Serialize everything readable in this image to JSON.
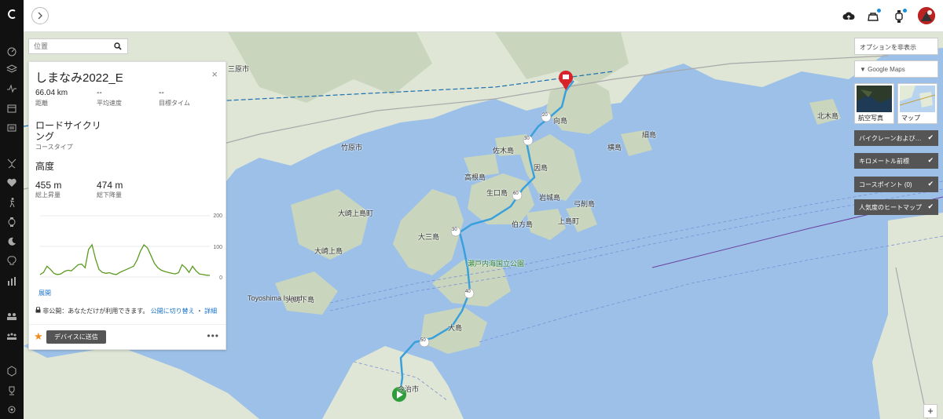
{
  "nav": {
    "icons": [
      "logo-icon",
      "dashboard-icon",
      "layers-icon",
      "activity-icon",
      "calendar-icon",
      "news-icon",
      "stretch-icon",
      "health-icon",
      "run-icon",
      "watch-icon",
      "sleep-icon",
      "insights-icon",
      "reports-icon",
      "connections-icon",
      "groups-icon",
      "badge-icon",
      "trophy-icon",
      "settings-icon"
    ]
  },
  "topbar": {
    "icons": [
      "upload-icon",
      "notifications-icon",
      "device-icon"
    ]
  },
  "search": {
    "placeholder": "位置"
  },
  "course": {
    "title": "しまなみ2022_E",
    "distance": "66.04 km",
    "distance_label": "距離",
    "avg_pace": "--",
    "avg_pace_label": "平均速度",
    "target_time": "--",
    "target_time_label": "目標タイム",
    "course_type": "ロードサイクリング",
    "course_type_label": "コースタイプ",
    "elevation_heading": "高度",
    "total_ascent": "455 m",
    "total_ascent_label": "総上昇量",
    "total_descent": "474 m",
    "total_descent_label": "総下降量",
    "expand_label": "展開",
    "privacy_text": "非公開：あなただけが利用できます。",
    "privacy_link": "公開に切り替え",
    "details_link": "詳細",
    "send_to_device": "デバイスに送信",
    "more": "•••",
    "star": "★",
    "close": "×"
  },
  "elevation_chart": {
    "type": "line",
    "ylim": [
      0,
      200
    ],
    "yticks": [
      "200",
      "100",
      "0"
    ],
    "values": [
      8,
      15,
      35,
      25,
      12,
      8,
      10,
      18,
      22,
      20,
      30,
      40,
      42,
      30,
      90,
      105,
      60,
      25,
      15,
      12,
      14,
      10,
      8,
      15,
      20,
      25,
      30,
      35,
      55,
      85,
      105,
      95,
      70,
      45,
      30,
      22,
      18,
      15,
      12,
      10,
      14,
      40,
      30,
      15,
      35,
      20,
      10,
      8,
      6,
      5
    ]
  },
  "right_panel": {
    "hide_options": "オプションを非表示",
    "gmaps_label": "Google Maps",
    "aerial_label": "航空写真",
    "map_label": "マップ",
    "layers": [
      {
        "label": "バイクレーンおよびト...",
        "check": "✔"
      },
      {
        "label": "キロメートル前標",
        "check": "✔"
      },
      {
        "label": "コースポイント (0)",
        "check": "✔"
      },
      {
        "label": "人気度のヒートマップ",
        "check": "✔"
      }
    ],
    "zoom_in": "+"
  },
  "map_labels": [
    {
      "t": "向島"
    },
    {
      "t": "因島"
    },
    {
      "t": "生口島"
    },
    {
      "t": "大三島"
    },
    {
      "t": "伯方島"
    },
    {
      "t": "大島"
    },
    {
      "t": "佐木島"
    },
    {
      "t": "高根島"
    },
    {
      "t": "大崎上島町"
    },
    {
      "t": "大崎上島"
    },
    {
      "t": "竹原市"
    },
    {
      "t": "瀬戸内海国立公園"
    },
    {
      "t": "横島"
    },
    {
      "t": "細島"
    },
    {
      "t": "岩城島"
    },
    {
      "t": "弓削島"
    },
    {
      "t": "上島町"
    },
    {
      "t": "北木島"
    },
    {
      "t": "大崎下島"
    },
    {
      "t": "Toyoshima Island"
    },
    {
      "t": "三原市"
    },
    {
      "t": "今治市"
    }
  ],
  "route_badges": [
    "50",
    "40",
    "30",
    "60",
    "30",
    "20",
    "10"
  ]
}
